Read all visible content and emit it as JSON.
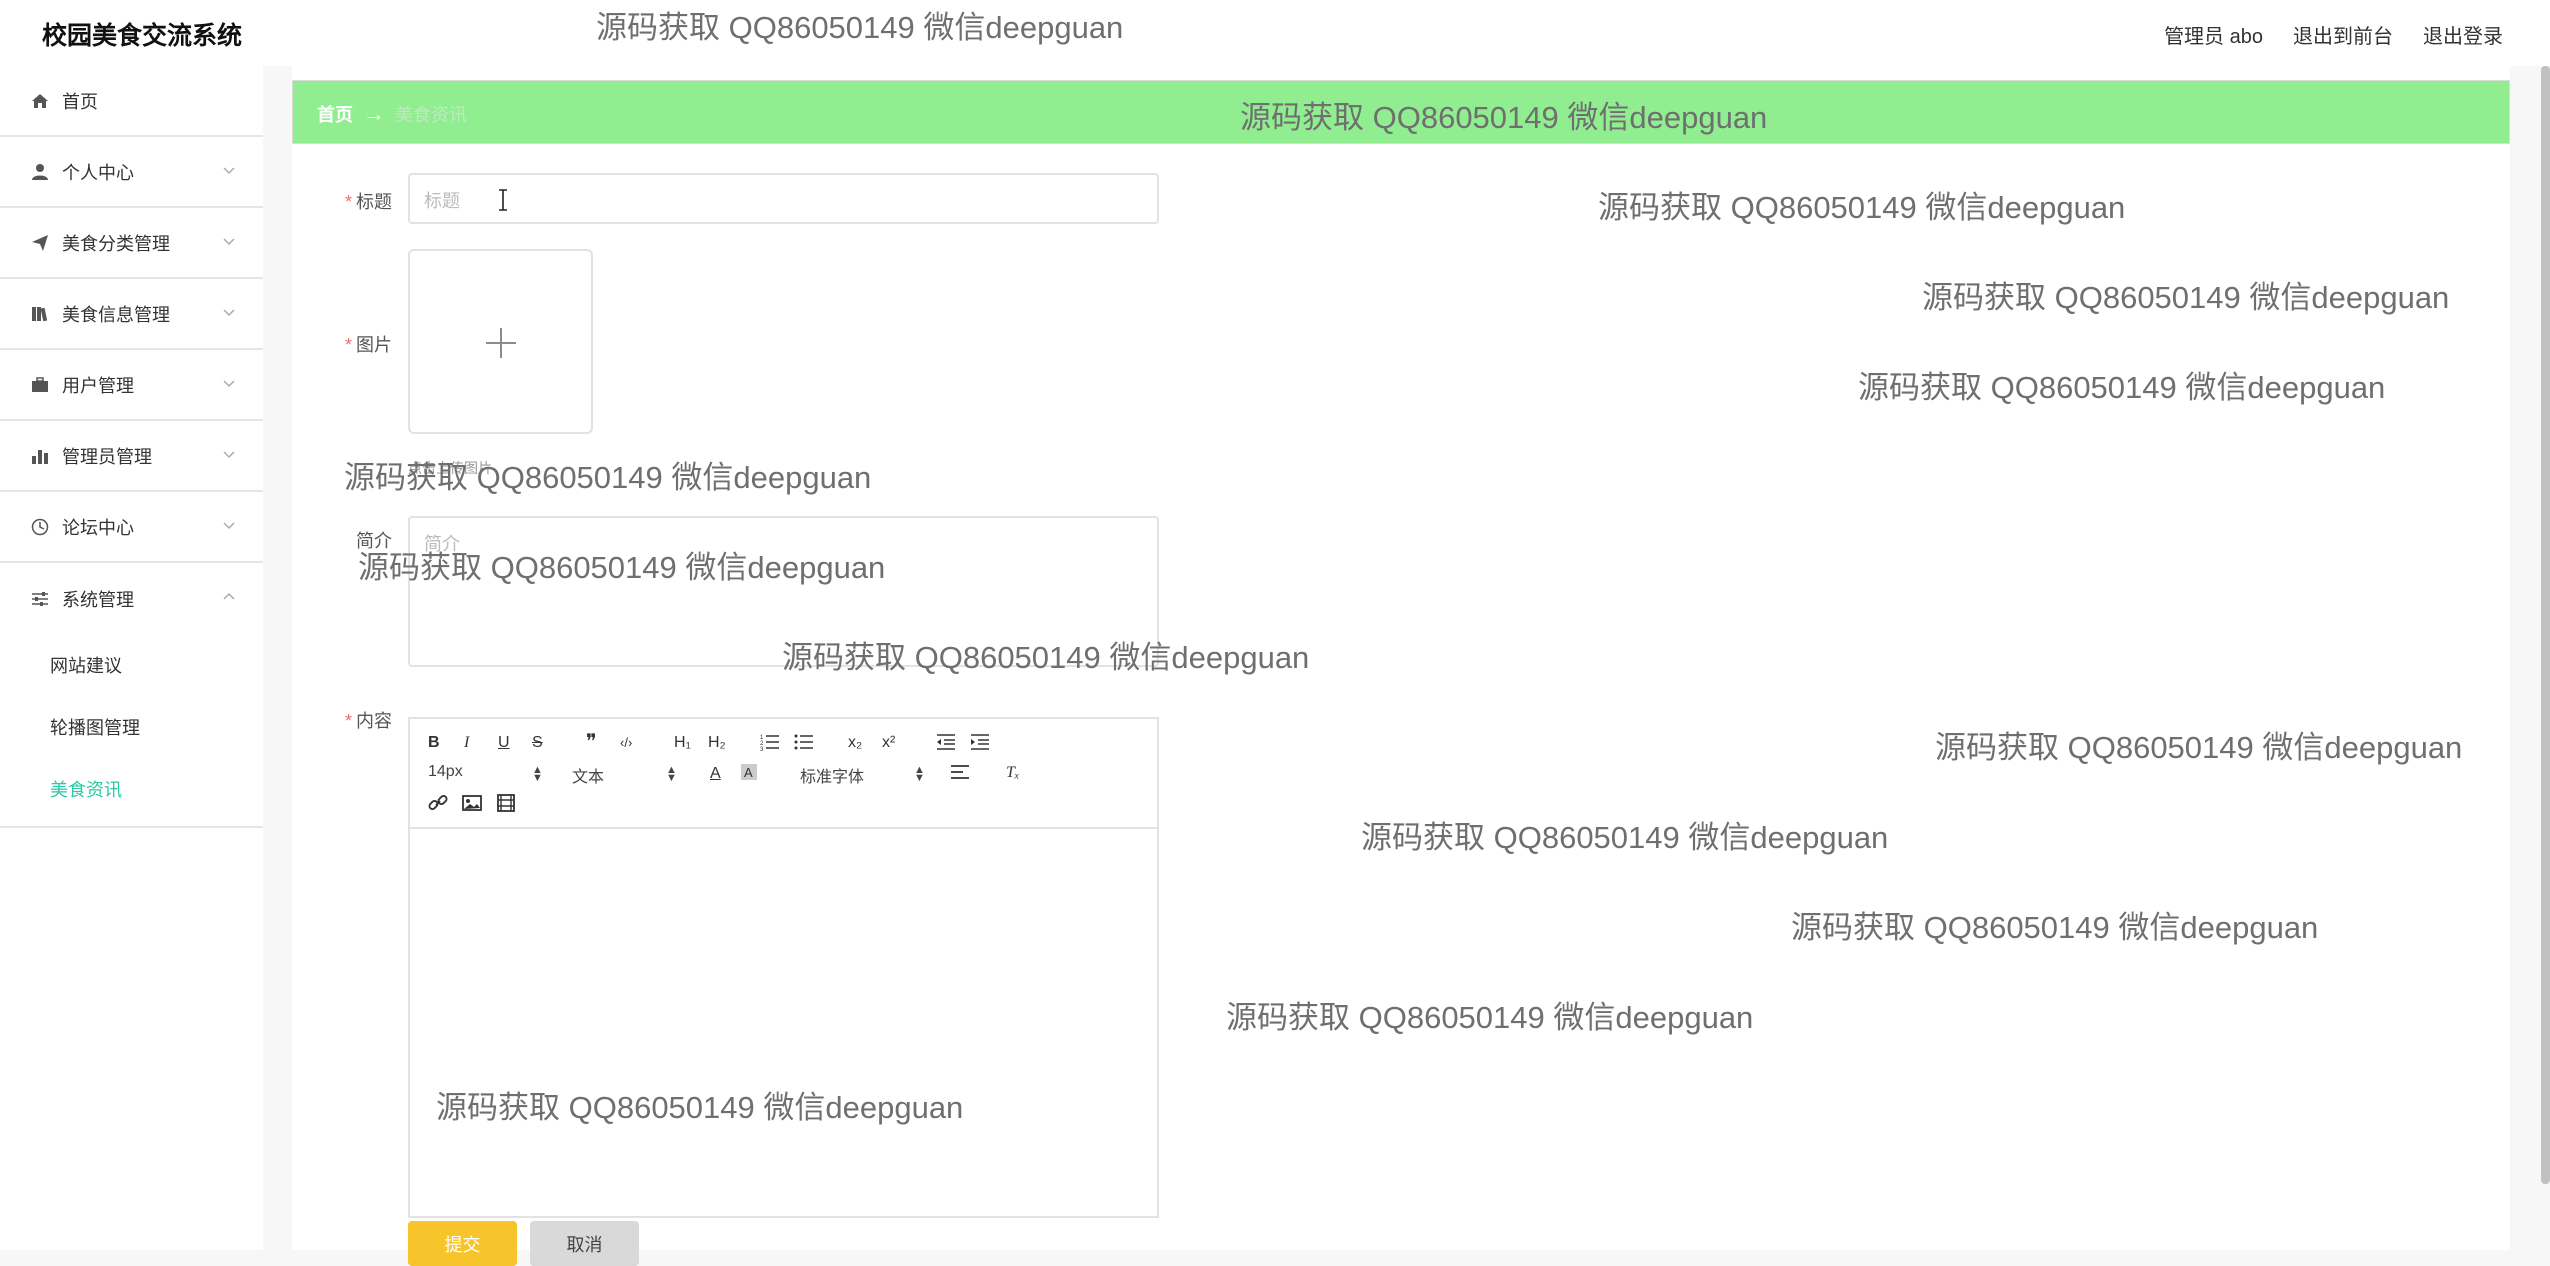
{
  "app": {
    "title": "校园美食交流系统"
  },
  "header": {
    "user_label": "管理员 abo",
    "front_link": "退出到前台",
    "logout_link": "退出登录"
  },
  "sidebar": {
    "items": [
      {
        "label": "首页",
        "icon": "home-icon"
      },
      {
        "label": "个人中心",
        "icon": "user-icon"
      },
      {
        "label": "美食分类管理",
        "icon": "send-icon"
      },
      {
        "label": "美食信息管理",
        "icon": "books-icon"
      },
      {
        "label": "用户管理",
        "icon": "briefcase-icon"
      },
      {
        "label": "管理员管理",
        "icon": "bar-chart-icon"
      },
      {
        "label": "论坛中心",
        "icon": "clock-icon"
      },
      {
        "label": "系统管理",
        "icon": "sliders-icon"
      }
    ],
    "sub_items": [
      "网站建议",
      "轮播图管理",
      "美食资讯"
    ],
    "active_color": "#2ec7a5"
  },
  "breadcrumb": {
    "home": "首页",
    "current": "美食资讯",
    "bar_color": "#90ee90"
  },
  "form": {
    "title_label": "标题",
    "title_placeholder": "标题",
    "image_label": "图片",
    "image_tip": "点击上传图片",
    "intro_label": "简介",
    "intro_placeholder": "简介",
    "content_label": "内容",
    "submit_label": "提交",
    "cancel_label": "取消"
  },
  "editor": {
    "font_size": "14px",
    "header_select": "文本",
    "font_select": "标准字体",
    "buttons": {
      "bold": "B",
      "italic": "I",
      "underline": "U",
      "strike": "S",
      "quote": "❞",
      "code": "‹/›",
      "h1": "H₁",
      "h2": "H₂",
      "sub": "x₂",
      "sup": "x²",
      "clean": "Tₓ"
    }
  },
  "watermark": "源码获取 QQ86050149 微信deepguan"
}
